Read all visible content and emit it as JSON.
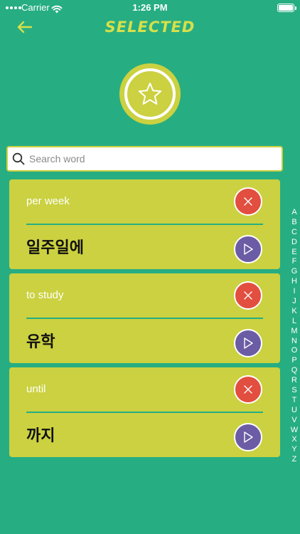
{
  "status_bar": {
    "carrier": "Carrier",
    "time": "1:26 PM"
  },
  "header": {
    "title": "SELECTED",
    "back_icon": "arrow-left-icon",
    "accent_color": "#d6e04a"
  },
  "badge": {
    "icon": "star-icon"
  },
  "search": {
    "placeholder": "Search word",
    "value": "",
    "icon": "search-icon"
  },
  "words": [
    {
      "english": "per week",
      "korean": "일주일에"
    },
    {
      "english": "to study",
      "korean": "유학"
    },
    {
      "english": "until",
      "korean": "까지"
    }
  ],
  "alphabet": [
    "A",
    "B",
    "C",
    "D",
    "E",
    "F",
    "G",
    "H",
    "I",
    "J",
    "K",
    "L",
    "M",
    "N",
    "O",
    "P",
    "Q",
    "R",
    "S",
    "T",
    "U",
    "V",
    "W",
    "X",
    "Y",
    "Z"
  ],
  "colors": {
    "background": "#27ad82",
    "card": "#cbd140",
    "delete": "#e24e3f",
    "play": "#6b5ca5"
  }
}
